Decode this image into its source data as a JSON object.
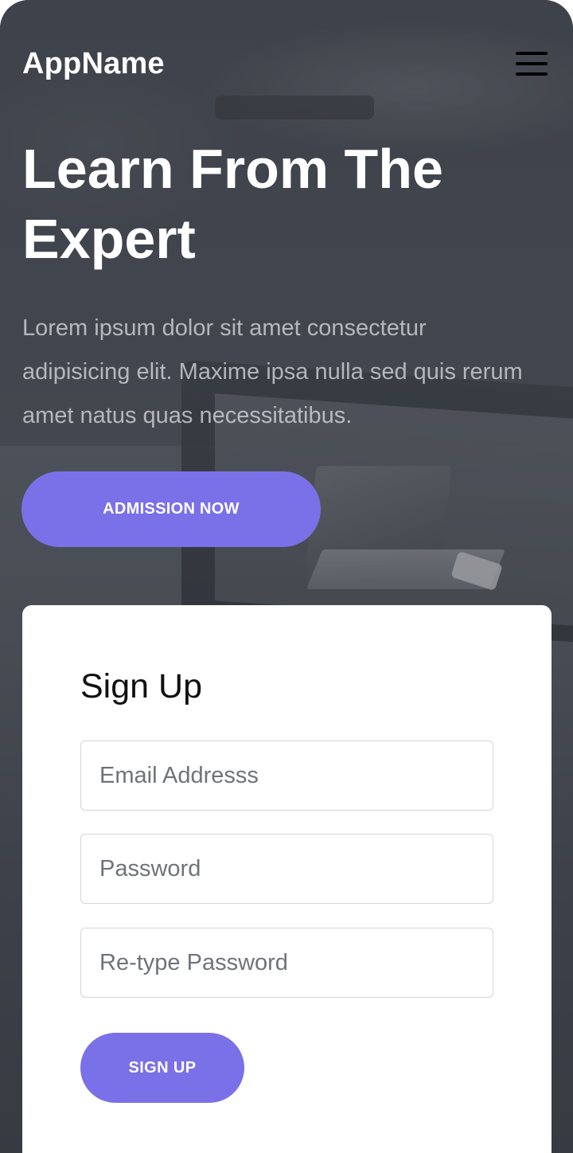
{
  "header": {
    "brand": "AppName",
    "menu_icon": "hamburger-menu-icon"
  },
  "hero": {
    "title": "Learn From The Expert",
    "text": "Lorem ipsum dolor sit amet consectetur adipisicing elit. Maxime ipsa nulla sed quis rerum amet natus quas necessitatibus.",
    "cta_label": "ADMISSION NOW"
  },
  "signup": {
    "title": "Sign Up",
    "email_placeholder": "Email Addresss",
    "password_placeholder": "Password",
    "retype_placeholder": "Re-type Password",
    "button_label": "SIGN UP"
  },
  "colors": {
    "accent": "#7a71e8",
    "card": "#ffffff",
    "hero_overlay": "#4a4e57"
  }
}
